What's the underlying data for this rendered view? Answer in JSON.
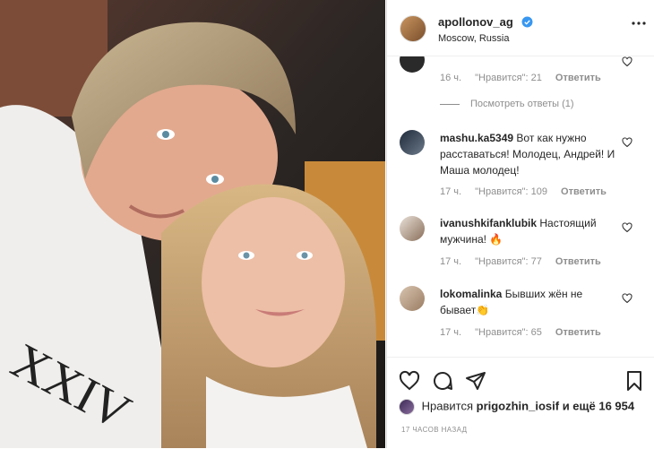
{
  "post": {
    "author": "apollonov_ag",
    "location": "Moscow, Russia"
  },
  "comments": [
    {
      "user": "",
      "text": "",
      "time": "16 ч.",
      "likes": "\"Нравится\": 21",
      "reply": "Ответить"
    },
    {
      "view_replies": "Посмотреть ответы (1)"
    },
    {
      "user": "mashu.ka5349",
      "text": "Вот как нужно расставаться! Молодец, Андрей! И Маша молодец!",
      "time": "17 ч.",
      "likes": "\"Нравится\": 109",
      "reply": "Ответить"
    },
    {
      "user": "ivanushkifanklubik",
      "text": "Настоящий мужчина! 🔥",
      "time": "17 ч.",
      "likes": "\"Нравится\": 77",
      "reply": "Ответить"
    },
    {
      "user": "lokomalinka",
      "text": "Бывших жён не бывает👏",
      "time": "17 ч.",
      "likes": "\"Нравится\": 65",
      "reply": "Ответить"
    }
  ],
  "actions": {
    "likes_prefix": "Нравится",
    "liked_by": "prigozhin_iosif",
    "likes_suffix": "и ещё 16 954",
    "posted": "17 ЧАСОВ НАЗАД"
  },
  "icons": {
    "verified": "verified-badge-icon",
    "more": "more-options-icon",
    "like": "heart-icon",
    "comment": "comment-bubble-icon",
    "share": "paper-plane-icon",
    "save": "bookmark-icon"
  },
  "colors": {
    "accent": "#3897f0",
    "text": "#262626",
    "muted": "#8e8e8e"
  }
}
